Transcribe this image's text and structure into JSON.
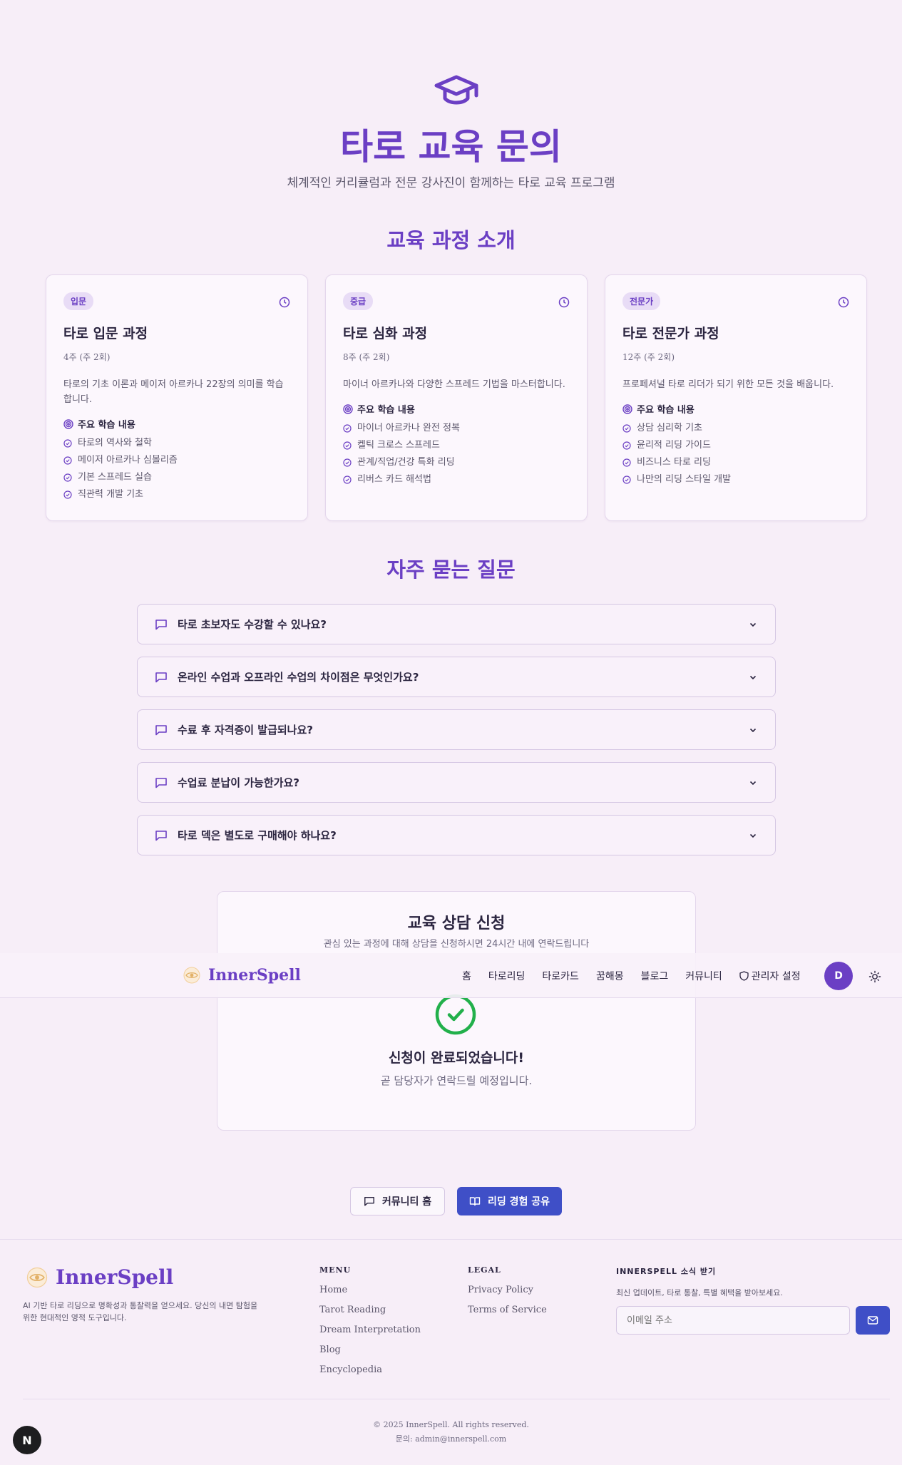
{
  "hero": {
    "icon": "graduation-cap-icon",
    "title": "타로 교육 문의",
    "subtitle": "체계적인 커리큘럼과 전문 강사진이 함께하는 타로 교육 프로그램"
  },
  "courses_section": {
    "title": "교육 과정 소개",
    "learn_heading": "주요 학습 내용",
    "courses": [
      {
        "badge": "입문",
        "title": "타로 입문 과정",
        "duration": "4주 (주 2회)",
        "description": "타로의 기초 이론과 메이저 아르카나 22장의 의미를 학습합니다.",
        "topics": [
          "타로의 역사와 철학",
          "메이저 아르카나 심볼리즘",
          "기본 스프레드 실습",
          "직관력 개발 기초"
        ]
      },
      {
        "badge": "중급",
        "title": "타로 심화 과정",
        "duration": "8주 (주 2회)",
        "description": "마이너 아르카나와 다양한 스프레드 기법을 마스터합니다.",
        "topics": [
          "마이너 아르카나 완전 정복",
          "켈틱 크로스 스프레드",
          "관계/직업/건강 특화 리딩",
          "리버스 카드 해석법"
        ]
      },
      {
        "badge": "전문가",
        "title": "타로 전문가 과정",
        "duration": "12주 (주 2회)",
        "description": "프로페셔널 타로 리더가 되기 위한 모든 것을 배웁니다.",
        "topics": [
          "상담 심리학 기초",
          "윤리적 리딩 가이드",
          "비즈니스 타로 리딩",
          "나만의 리딩 스타일 개발"
        ]
      }
    ]
  },
  "faq_section": {
    "title": "자주 묻는 질문",
    "items": [
      "타로 초보자도 수강할 수 있나요?",
      "온라인 수업과 오프라인 수업의 차이점은 무엇인가요?",
      "수료 후 자격증이 발급되나요?",
      "수업료 분납이 가능한가요?",
      "타로 덱은 별도로 구매해야 하나요?"
    ]
  },
  "consult": {
    "title": "교육 상담 신청",
    "subtitle": "관심 있는 과정에 대해 상담을 신청하시면 24시간 내에 연락드립니다",
    "success_title": "신청이 완료되었습니다!",
    "success_sub": "곧 담당자가 연락드릴 예정입니다."
  },
  "nav": {
    "brand": "InnerSpell",
    "links": [
      "홈",
      "타로리딩",
      "타로카드",
      "꿈해몽",
      "블로그",
      "커뮤니티"
    ],
    "admin": "관리자 설정",
    "avatar": "D"
  },
  "actions": {
    "community_home": "커뮤니티 홈",
    "share_reading": "리딩 경험 공유"
  },
  "footer": {
    "brand": "InnerSpell",
    "description": "AI 기반 타로 리딩으로 명확성과 통찰력을 얻으세요. 당신의 내면 탐험을 위한 현대적인 영적 도구입니다.",
    "menu_head": "MENU",
    "menu": [
      "Home",
      "Tarot Reading",
      "Dream Interpretation",
      "Blog",
      "Encyclopedia"
    ],
    "legal_head": "LEGAL",
    "legal": [
      "Privacy Policy",
      "Terms of Service"
    ],
    "news_head": "INNERSPELL 소식 받기",
    "news_sub": "최신 업데이트, 타로 통찰, 특별 혜택을 받아보세요.",
    "email_placeholder": "이메일 주소",
    "copyright": "© 2025 InnerSpell. All rights reserved.",
    "contact": "문의: admin@innerspell.com"
  },
  "dev_badge": "N",
  "colors": {
    "accent": "#6b3fc4",
    "primary_button": "#3f4fc7",
    "success": "#22b04b",
    "background": "#f7eef8"
  }
}
